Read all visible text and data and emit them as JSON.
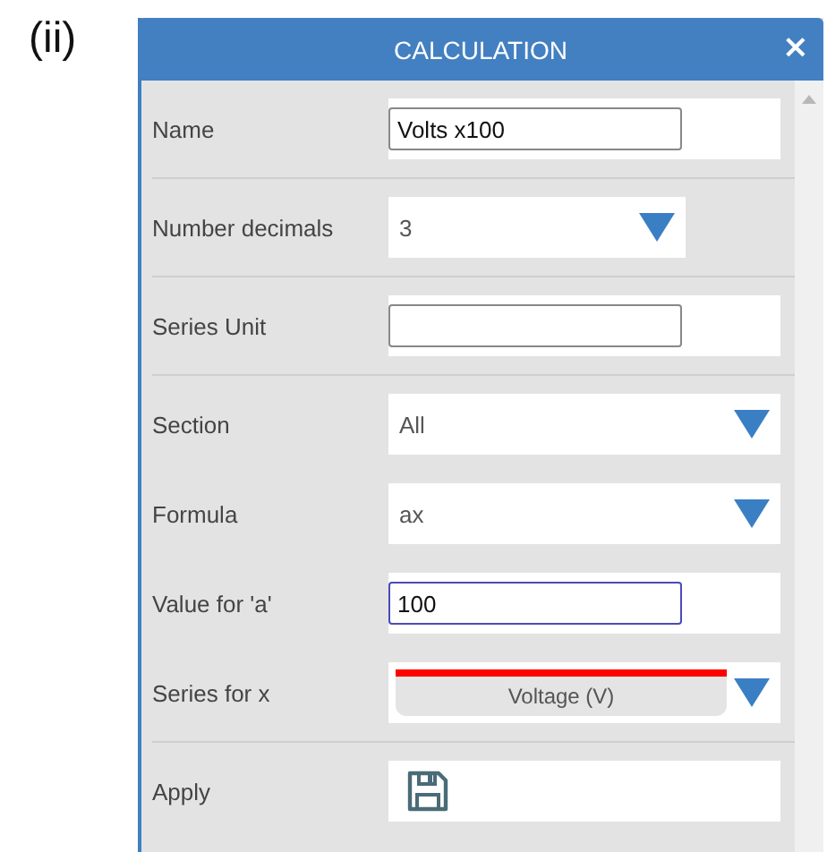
{
  "figure_label": "(ii)",
  "dialog": {
    "title": "CALCULATION",
    "close": "×",
    "groups": [
      [
        {
          "kind": "input",
          "label": "Name",
          "value": "Volts x100",
          "focused": false
        }
      ],
      [
        {
          "kind": "select",
          "label": "Number decimals",
          "value": "3"
        }
      ],
      [
        {
          "kind": "input",
          "label": "Series Unit",
          "focused": false
        }
      ],
      [
        {
          "kind": "select-wide",
          "label": "Section",
          "value": "All"
        },
        {
          "kind": "select-wide",
          "label": "Formula",
          "value": "ax"
        },
        {
          "kind": "input",
          "label": "Value for 'a'",
          "value": "100",
          "focused": true
        },
        {
          "kind": "series",
          "label": "Series for x",
          "value": "Voltage  (V)",
          "color": "#ff0000"
        }
      ],
      [
        {
          "kind": "action",
          "label": "Apply"
        }
      ]
    ]
  }
}
